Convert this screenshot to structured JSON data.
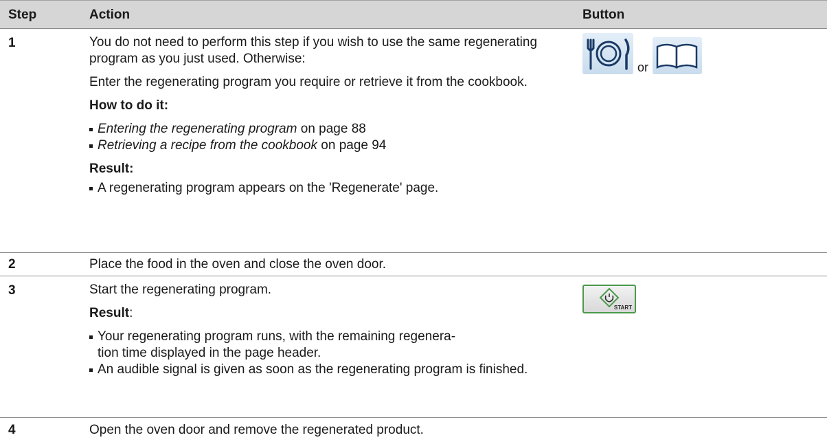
{
  "header": {
    "step": "Step",
    "action": "Action",
    "button": "Button"
  },
  "rows": [
    {
      "step": "1",
      "intro": "You do not need to perform this step if you wish to use the same regenerating program as you just used. Otherwise:",
      "enter": "Enter the regenerating program you require or retrieve it from the cookbook.",
      "howto_label": "How to do it:",
      "howto": [
        {
          "ref": "Entering the regenerating program",
          "page": " on page 88"
        },
        {
          "ref": "Retrieving a recipe from the cookbook",
          "page": " on page 94"
        }
      ],
      "result_label": "Result:",
      "result": [
        "A regenerating program appears on the 'Regenerate' page."
      ],
      "or": "or"
    },
    {
      "step": "2",
      "text": "Place the food in the oven and close the oven door."
    },
    {
      "step": "3",
      "text": "Start the regenerating program.",
      "result_label": "Result",
      "result_colon": ":",
      "result": [
        "Your regenerating program runs, with the remaining regenera- tion time displayed in the page header.",
        "An audible signal is given as soon as the regenerating program is finished."
      ],
      "start_label": "START"
    },
    {
      "step": "4",
      "text": "Open the oven door and remove the regenerated product."
    }
  ],
  "icons": {
    "plate": "plate-cutlery-icon",
    "book": "cookbook-icon",
    "start": "start-power-icon"
  },
  "colors": {
    "header_bg": "#d6d6d6",
    "icon_bg": "#d4e4f2",
    "start_border": "#4a9a4a"
  }
}
